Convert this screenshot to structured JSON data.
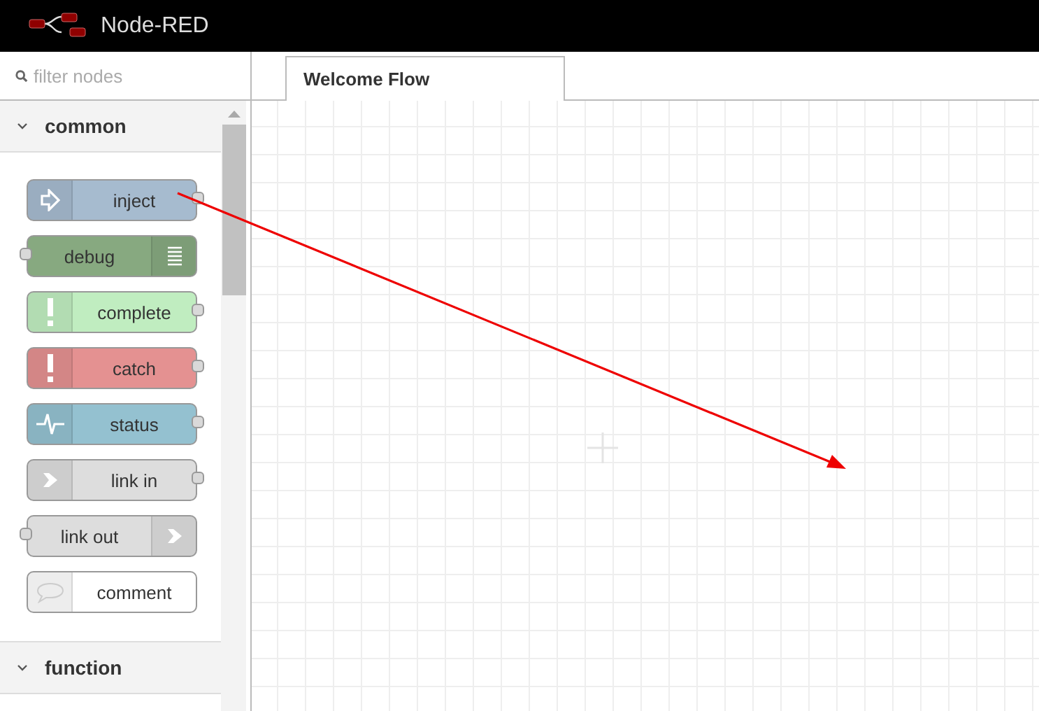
{
  "header": {
    "title": "Node-RED"
  },
  "palette": {
    "search": {
      "placeholder": "filter nodes"
    },
    "categories": [
      {
        "label": "common",
        "expanded": true,
        "nodes": [
          {
            "label": "inject",
            "color": "#a6bbcf",
            "kind": "inject"
          },
          {
            "label": "debug",
            "color": "#87a980",
            "kind": "debug"
          },
          {
            "label": "complete",
            "color": "#c0edc0",
            "kind": "complete"
          },
          {
            "label": "catch",
            "color": "#e49191",
            "kind": "catch"
          },
          {
            "label": "status",
            "color": "#94c1d0",
            "kind": "status"
          },
          {
            "label": "link in",
            "color": "#dddddd",
            "kind": "linkin"
          },
          {
            "label": "link out",
            "color": "#dddddd",
            "kind": "linkout"
          },
          {
            "label": "comment",
            "color": "#ffffff",
            "kind": "comment"
          }
        ]
      },
      {
        "label": "function",
        "expanded": true
      }
    ]
  },
  "workspace": {
    "tabs": [
      {
        "label": "Welcome Flow",
        "selected": true
      }
    ]
  }
}
